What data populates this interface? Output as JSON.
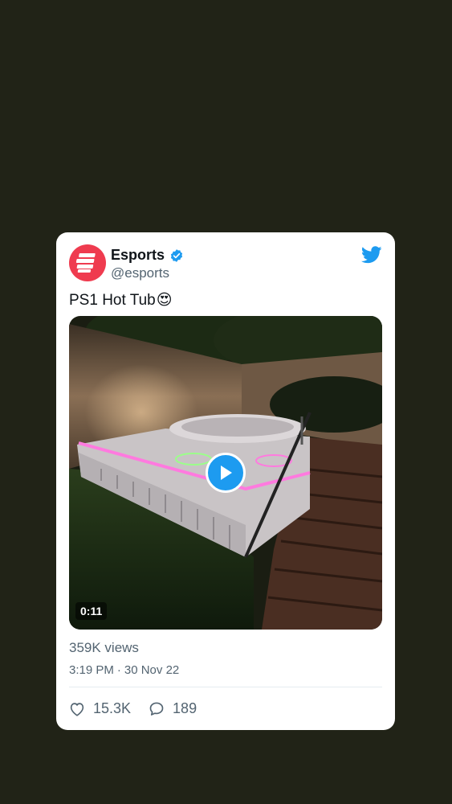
{
  "tweet": {
    "author_name": "Esports",
    "author_handle": "@esports",
    "text": "PS1 Hot Tub",
    "emoji": "😍",
    "verified": true,
    "video_duration": "0:11",
    "views": "359K views",
    "time": "3:19 PM",
    "separator": "·",
    "date": "30 Nov 22",
    "likes": "15.3K",
    "replies": "189"
  },
  "colors": {
    "background": "#212317",
    "brand_blue": "#1d9bf0",
    "avatar_red": "#ef3b4f"
  },
  "icons": [
    "verified-badge-icon",
    "twitter-bird-icon",
    "play-icon",
    "heart-icon",
    "reply-icon"
  ]
}
